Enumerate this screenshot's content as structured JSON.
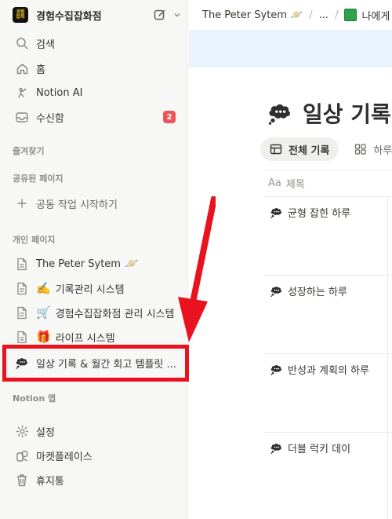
{
  "workspace": {
    "name": "경험수집잡화점",
    "logo_text": "경험수집\n잡화점"
  },
  "nav": {
    "search": "검색",
    "home": "홈",
    "notion_ai": "Notion AI",
    "inbox": "수신함",
    "inbox_badge": "2"
  },
  "sections": {
    "favorites": "즐겨찾기",
    "shared": "공유된 페이지",
    "shared_start": "공동 작업 시작하기",
    "private": "개인 페이지",
    "notion_app": "Notion 앱"
  },
  "private_pages": [
    {
      "label": "The Peter Sytem",
      "icon": "page-icon",
      "emoji": "",
      "trailing": "🪐"
    },
    {
      "label": "기록관리 시스템",
      "icon": "page-icon",
      "emoji": "✍️",
      "trailing": ""
    },
    {
      "label": "경험수집잡화점 관리 시스템",
      "icon": "page-icon",
      "emoji": "🛒",
      "trailing": ""
    },
    {
      "label": "라이프 시스템",
      "icon": "page-icon",
      "emoji": "🎁",
      "trailing": ""
    },
    {
      "label": "일상 기록 & 월간 회고 템플릿 ...",
      "icon": "thought-bubble-icon",
      "emoji": "",
      "trailing": ""
    }
  ],
  "app_items": {
    "settings": "설정",
    "marketplace": "마켓플레이스",
    "trash": "휴지통"
  },
  "breadcrumb": {
    "first": "The Peter Sytem 🪐",
    "ellipsis": "...",
    "last": "나에게"
  },
  "page": {
    "title": "일상 기록",
    "tab_all": "전체 기록",
    "tab_day": "하루",
    "col_title": "제목"
  },
  "rows": [
    "균형 잡힌 하루",
    "성장하는 하루",
    "반성과 계획의 하루",
    "더블 럭키 데이"
  ],
  "colors": {
    "highlight": "#e8131f",
    "badge": "#eb5757",
    "banner": "#e9f3fd"
  }
}
